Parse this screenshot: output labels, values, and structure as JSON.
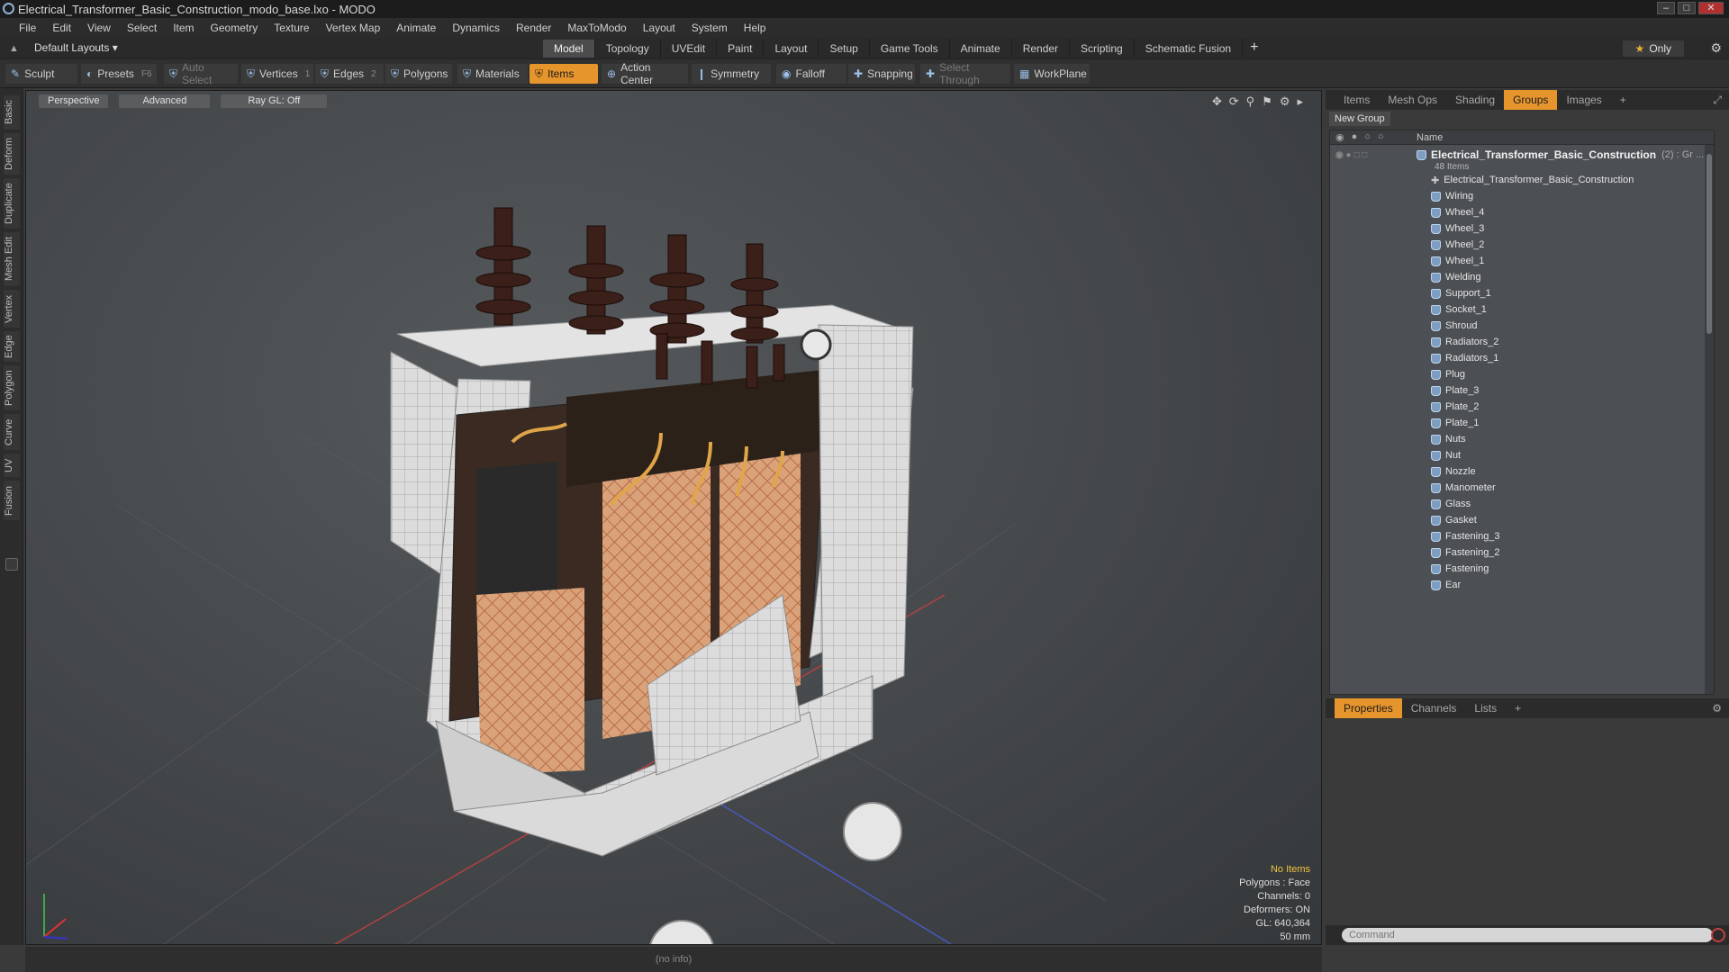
{
  "window": {
    "title": "Electrical_Transformer_Basic_Construction_modo_base.lxo - MODO"
  },
  "menu": [
    "File",
    "Edit",
    "View",
    "Select",
    "Item",
    "Geometry",
    "Texture",
    "Vertex Map",
    "Animate",
    "Dynamics",
    "Render",
    "MaxToModo",
    "Layout",
    "System",
    "Help"
  ],
  "layout": {
    "dropdown": "Default Layouts ▾",
    "only": "Only"
  },
  "tabs": [
    "Model",
    "Topology",
    "UVEdit",
    "Paint",
    "Layout",
    "Setup",
    "Game Tools",
    "Animate",
    "Render",
    "Scripting",
    "Schematic Fusion"
  ],
  "toolbar": {
    "sculpt": "Sculpt",
    "presets": "Presets",
    "presets_key": "F6",
    "auto_select": "Auto Select",
    "vertices": "Vertices",
    "vertices_count": "1",
    "edges": "Edges",
    "edges_count": "2",
    "polygons": "Polygons",
    "materials": "Materials",
    "items": "Items",
    "action_center": "Action Center",
    "symmetry": "Symmetry",
    "falloff": "Falloff",
    "snapping": "Snapping",
    "select_through": "Select Through",
    "workplane": "WorkPlane"
  },
  "left_tabs": [
    "Basic",
    "Deform",
    "Duplicate",
    "Mesh Edit",
    "Vertex",
    "Edge",
    "Polygon",
    "Curve",
    "UV",
    "Fusion"
  ],
  "viewport": {
    "perspective": "Perspective",
    "advanced": "Advanced",
    "raygl": "Ray GL: Off",
    "info": {
      "no_items": "No Items",
      "polygons": "Polygons : Face",
      "channels": "Channels: 0",
      "deformers": "Deformers: ON",
      "gl": "GL: 640,364",
      "scale": "50 mm"
    }
  },
  "panel": {
    "tabs": [
      "Items",
      "Mesh Ops",
      "Shading",
      "Groups",
      "Images"
    ],
    "new_group": "New Group",
    "name_header": "Name",
    "group": {
      "name": "Electrical_Transformer_Basic_Construction",
      "count": "(2) : Gr ...",
      "items": "48 Items"
    },
    "locator": "Electrical_Transformer_Basic_Construction",
    "meshes": [
      "Wiring",
      "Wheel_4",
      "Wheel_3",
      "Wheel_2",
      "Wheel_1",
      "Welding",
      "Support_1",
      "Socket_1",
      "Shroud",
      "Radiators_2",
      "Radiators_1",
      "Plug",
      "Plate_3",
      "Plate_2",
      "Plate_1",
      "Nuts",
      "Nut",
      "Nozzle",
      "Manometer",
      "Glass",
      "Gasket",
      "Fastening_3",
      "Fastening_2",
      "Fastening",
      "Ear"
    ],
    "prop_tabs": [
      "Properties",
      "Channels",
      "Lists"
    ],
    "command_placeholder": "Command"
  },
  "status": {
    "text": "(no info)"
  },
  "colors": {
    "accent": "#e6952d",
    "mesh_icon": "#7d9ec2"
  }
}
